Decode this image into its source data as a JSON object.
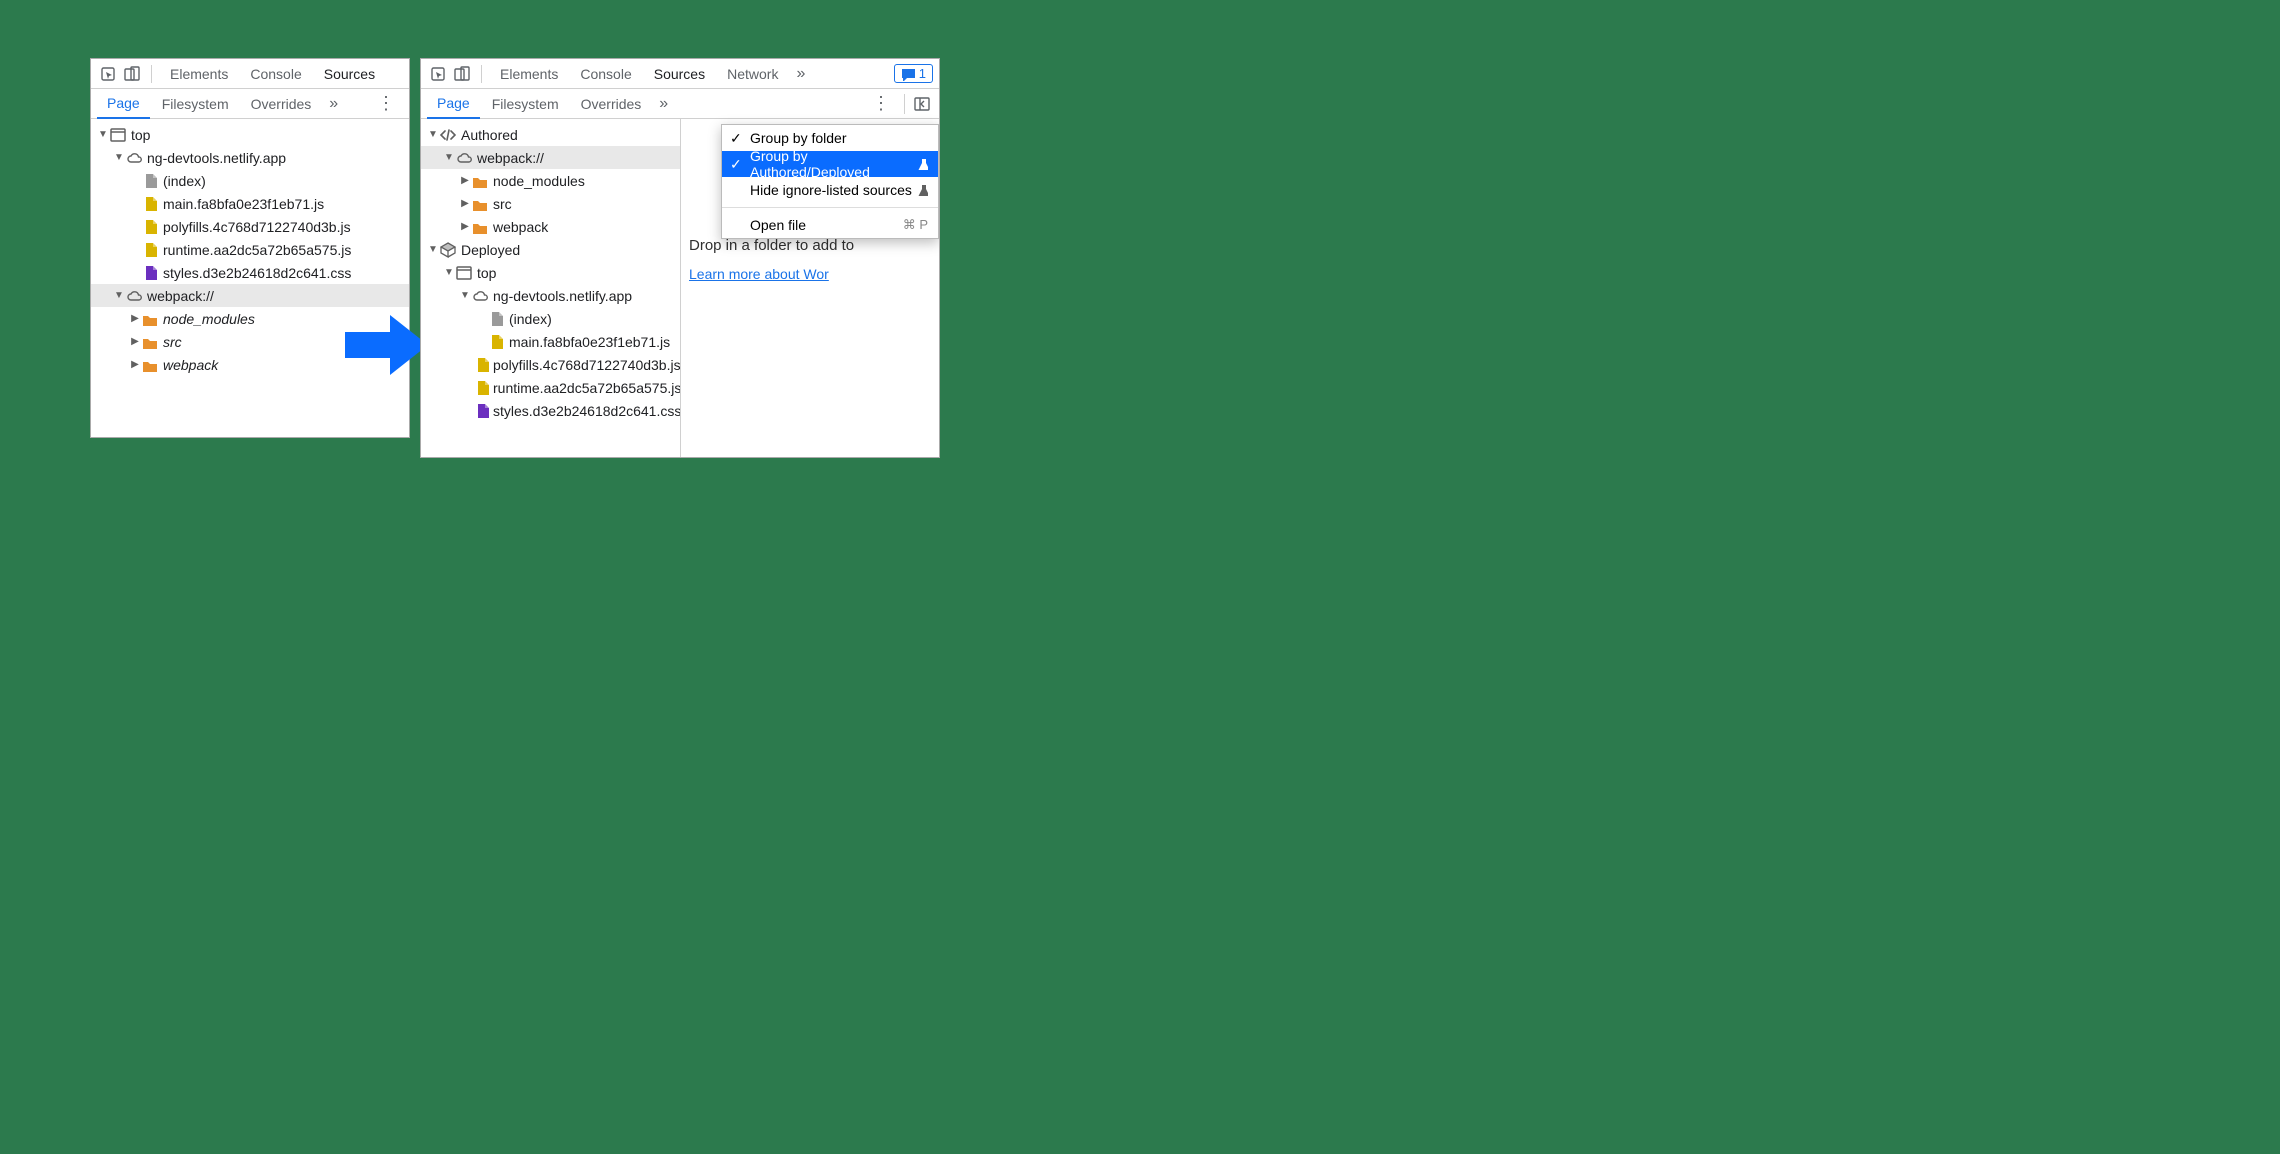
{
  "left": {
    "tabs": [
      "Elements",
      "Console",
      "Sources"
    ],
    "active_tab": "Sources",
    "subtabs": [
      "Page",
      "Filesystem",
      "Overrides"
    ],
    "active_subtab": "Page",
    "tree": {
      "top": "top",
      "domain": "ng-devtools.netlify.app",
      "files": [
        {
          "name": "(index)",
          "type": "file-gray"
        },
        {
          "name": "main.fa8bfa0e23f1eb71.js",
          "type": "file-js"
        },
        {
          "name": "polyfills.4c768d7122740d3b.js",
          "type": "file-js"
        },
        {
          "name": "runtime.aa2dc5a72b65a575.js",
          "type": "file-js"
        },
        {
          "name": "styles.d3e2b24618d2c641.css",
          "type": "file-css"
        }
      ],
      "webpack": "webpack://",
      "webpack_folders": [
        "node_modules",
        "src",
        "webpack"
      ]
    }
  },
  "right": {
    "tabs": [
      "Elements",
      "Console",
      "Sources",
      "Network"
    ],
    "active_tab": "Sources",
    "issues_count": "1",
    "subtabs": [
      "Page",
      "Filesystem",
      "Overrides"
    ],
    "active_subtab": "Page",
    "tree": {
      "authored": "Authored",
      "webpack": "webpack://",
      "webpack_folders": [
        "node_modules",
        "src",
        "webpack"
      ],
      "deployed": "Deployed",
      "top": "top",
      "domain": "ng-devtools.netlify.app",
      "files": [
        {
          "name": "(index)",
          "type": "file-gray"
        },
        {
          "name": "main.fa8bfa0e23f1eb71.js",
          "type": "file-js"
        },
        {
          "name": "polyfills.4c768d7122740d3b.js",
          "type": "file-js"
        },
        {
          "name": "runtime.aa2dc5a72b65a575.js",
          "type": "file-js"
        },
        {
          "name": "styles.d3e2b24618d2c641.css",
          "type": "file-css"
        }
      ]
    },
    "ctxmenu": {
      "group_folder": "Group by folder",
      "group_authored": "Group by Authored/Deployed",
      "hide_ignore": "Hide ignore-listed sources",
      "open_file": "Open file",
      "open_file_shortcut": "⌘ P"
    },
    "pane": {
      "drop_text": "Drop in a folder to add to",
      "learn_more": "Learn more about Wor"
    }
  }
}
